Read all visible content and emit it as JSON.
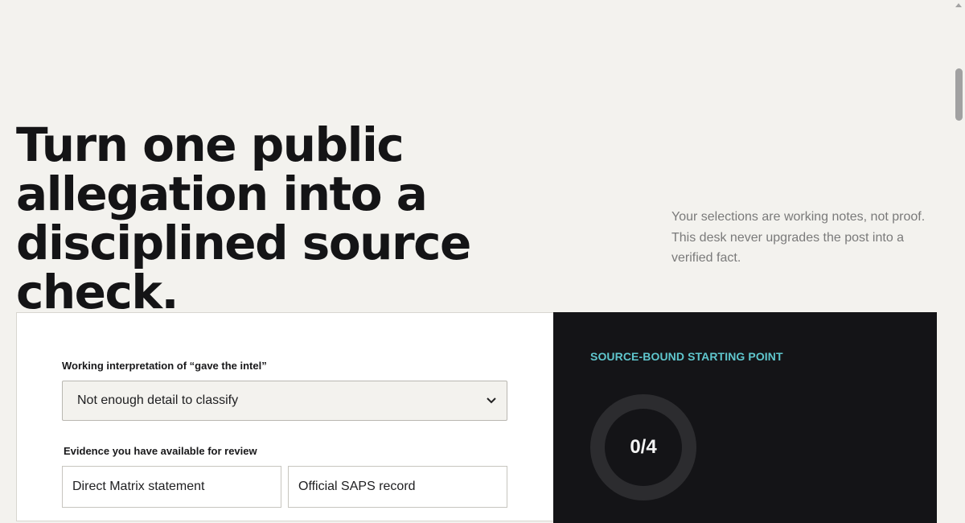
{
  "hero": {
    "title": "Turn one public allegation into a disciplined source check.",
    "note": "Your selections are working notes, not proof. This desk never upgrades the post into a verified fact."
  },
  "form": {
    "interpretation_label": "Working interpretation of “gave the intel”",
    "interpretation_value": "Not enough detail to classify",
    "evidence_label": "Evidence you have available for review",
    "evidence_options": [
      "Direct Matrix statement",
      "Official SAPS record"
    ]
  },
  "result": {
    "label": "SOURCE-BOUND STARTING POINT",
    "score_text": "0/4",
    "score": 0,
    "score_max": 4,
    "accent_color": "#5fc6cd",
    "ring_color": "#2c2c2f"
  },
  "icons": {
    "select_chevron": "chevron-down-icon"
  }
}
